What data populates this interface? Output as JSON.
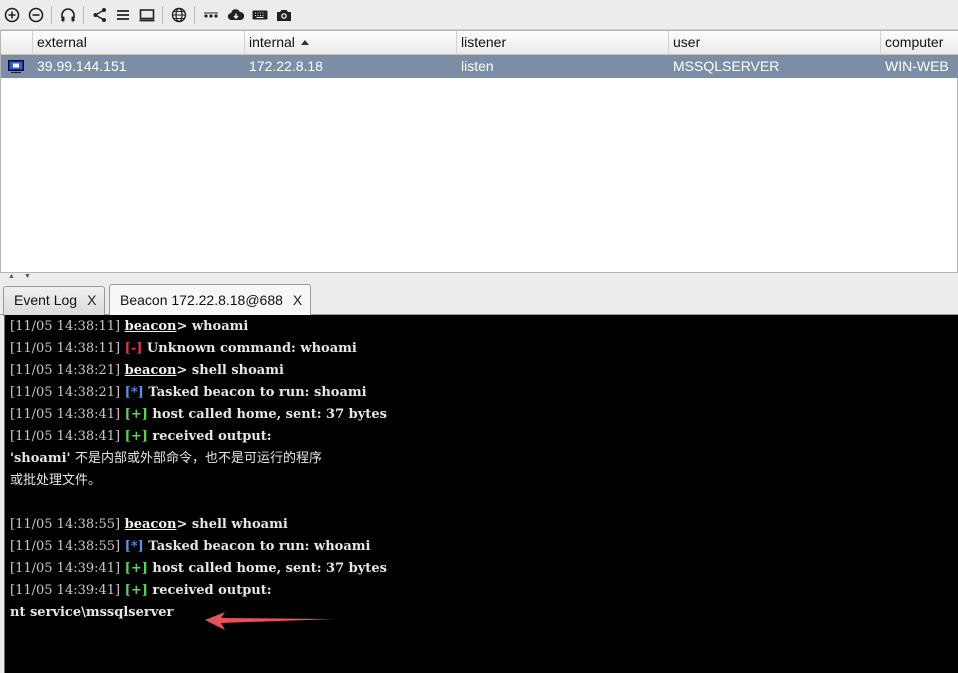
{
  "toolbar": {
    "icons": [
      "plus-circle-icon",
      "minus-circle-icon",
      "headphones-icon",
      "share-icon",
      "list-icon",
      "monitor-icon",
      "globe-icon",
      "dots-icon",
      "cloud-download-icon",
      "keyboard-icon",
      "camera-icon"
    ]
  },
  "table": {
    "columns": [
      "external",
      "internal",
      "listener",
      "user",
      "computer"
    ],
    "sorted_column": "internal",
    "rows": [
      {
        "external": "39.99.144.151",
        "internal": "172.22.8.18",
        "listener": "listen",
        "user": "MSSQLSERVER",
        "computer": "WIN-WEB"
      }
    ],
    "selected_row_color": "#7b8ea6"
  },
  "tabs": [
    {
      "label": "Event Log",
      "close": "X"
    },
    {
      "label": "Beacon 172.22.8.18@688",
      "close": "X"
    }
  ],
  "console": {
    "lines": [
      {
        "ts": "[11/05 14:38:11]",
        "prompt": "beacon",
        "rest": "> whoami"
      },
      {
        "ts": "[11/05 14:38:11]",
        "tag": "[-]",
        "tag_type": "err",
        "rest": " Unknown command: whoami"
      },
      {
        "ts": "[11/05 14:38:21]",
        "prompt": "beacon",
        "rest": "> shell shoami"
      },
      {
        "ts": "[11/05 14:38:21]",
        "tag": "[*]",
        "tag_type": "info",
        "rest": " Tasked beacon to run: shoami"
      },
      {
        "ts": "[11/05 14:38:41]",
        "tag": "[+]",
        "tag_type": "ok",
        "rest": " host called home, sent: 37 bytes"
      },
      {
        "ts": "[11/05 14:38:41]",
        "tag": "[+]",
        "tag_type": "ok",
        "rest": " received output:"
      },
      {
        "raw": "'shoami' ",
        "cn": "不是内部或外部命令，也不是可运行的程序"
      },
      {
        "cn": "或批处理文件。"
      },
      {
        "raw": ""
      },
      {
        "ts": "[11/05 14:38:55]",
        "prompt": "beacon",
        "rest": "> shell whoami"
      },
      {
        "ts": "[11/05 14:38:55]",
        "tag": "[*]",
        "tag_type": "info",
        "rest": " Tasked beacon to run: whoami"
      },
      {
        "ts": "[11/05 14:39:41]",
        "tag": "[+]",
        "tag_type": "ok",
        "rest": " host called home, sent: 37 bytes"
      },
      {
        "ts": "[11/05 14:39:41]",
        "tag": "[+]",
        "tag_type": "ok",
        "rest": " received output:"
      },
      {
        "raw": "nt service\\mssqlserver"
      }
    ],
    "annotation_arrow_color": "#e8505b"
  }
}
